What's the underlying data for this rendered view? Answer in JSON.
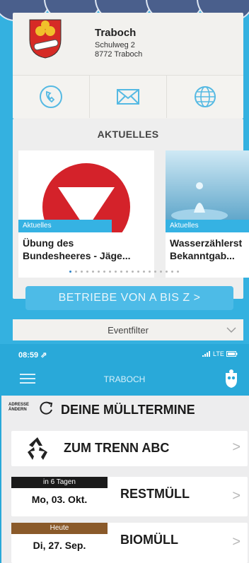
{
  "address": {
    "name": "Traboch",
    "street": "Schulweg 2",
    "city": "8772 Traboch"
  },
  "section_title": "AKTUELLES",
  "news": [
    {
      "tag": "Aktuelles",
      "title_line1": "Übung des",
      "title_line2": "Bundesheeres - Jäge..."
    },
    {
      "tag": "Aktuelles",
      "title_line1": "Wasserzählerst",
      "title_line2": "Bekanntgab..."
    }
  ],
  "az_button": "BETRIEBE VON A BIS Z  >",
  "eventfilter": "Eventfilter",
  "status": {
    "time": "08:59 ⇗",
    "network": "LTE"
  },
  "app_title": "TRABOCH",
  "address_change": {
    "line1": "ADRESSE",
    "line2": "ÄNDERN"
  },
  "waste_title": "DEINE MÜLLTERMINE",
  "trenn_abc": "ZUM TRENN ABC",
  "waste_items": [
    {
      "when": "in 6 Tagen",
      "date": "Mo, 03. Okt.",
      "name": "RESTMÜLL",
      "color": "#1a1a1a"
    },
    {
      "when": "Heute",
      "date": "Di, 27. Sep.",
      "name": "BIOMÜLL",
      "color": "#8a5a2a"
    }
  ]
}
